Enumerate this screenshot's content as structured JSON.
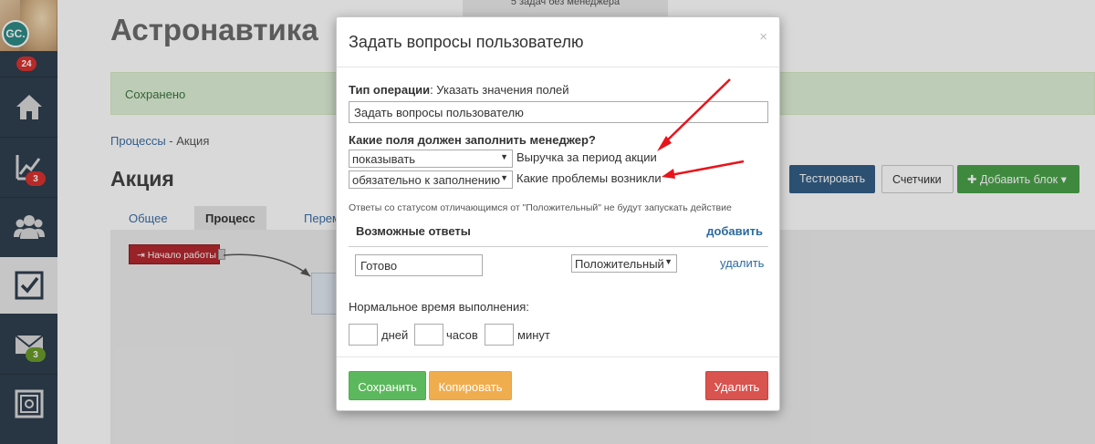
{
  "sidebar": {
    "user_initials": "GC.",
    "notifications_count": "24",
    "analytics_count": "3",
    "mail_count": "3"
  },
  "background": {
    "top_notice": "5 задач без менеджера",
    "page_title": "Астронавтика",
    "alert_text": "Сохранено",
    "breadcrumb": {
      "parent": "Процессы",
      "separator": " - ",
      "current": "Акция"
    },
    "section_title": "Акция",
    "tabs": [
      {
        "label": "Общее"
      },
      {
        "label": "Процесс"
      },
      {
        "label": "Перем"
      }
    ],
    "start_node_label": "Начало работы",
    "toolbar": {
      "test_label": "Тестировать",
      "counters_label": "Счетчики",
      "add_block_label": "Добавить блок"
    }
  },
  "modal": {
    "title": "Задать вопросы пользователю",
    "close_glyph": "×",
    "operation_label": "Тип операции",
    "operation_value": ": Указать значения полей",
    "question_value": "Задать вопросы пользователю",
    "fields_label": "Какие поля должен заполнить менеджер?",
    "fields": [
      {
        "mode": "показывать",
        "name": "Выручка за период акции"
      },
      {
        "mode": "обязательно к заполнению",
        "name": "Какие проблемы возникли"
      }
    ],
    "status_note": "Ответы со статусом отличающимся от \"Положительный\" не будут запускать действие",
    "answers_title": "Возможные ответы",
    "answers_add": "добавить",
    "answers": [
      {
        "text": "Готово",
        "status": "Положительный",
        "delete_label": "удалить"
      }
    ],
    "time_label": "Нормальное время выполнения:",
    "time_units": {
      "days": "дней",
      "hours": "часов",
      "minutes": "минут"
    },
    "buttons": {
      "save": "Сохранить",
      "copy": "Копировать",
      "delete": "Удалить"
    }
  },
  "colors": {
    "sidebar_bg": "#2f3f4f",
    "annotation_arrow": "#e8141b",
    "save": "#5cb85c",
    "copy": "#f0ad4e",
    "delete": "#d9534f",
    "link": "#2c6aa0"
  }
}
